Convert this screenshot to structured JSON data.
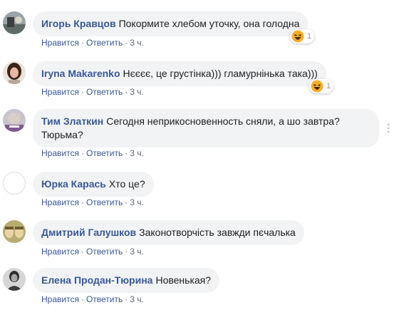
{
  "actions": {
    "like": "Нравится",
    "reply": "Ответить",
    "separator": "·"
  },
  "comments": [
    {
      "author": "Игорь Кравцов",
      "text": "Покормите хлебом уточку, она голодна",
      "time": "3 ч.",
      "reaction_icon": "haha-icon",
      "reaction_count": "1"
    },
    {
      "author": "Iryna Makarenko",
      "text": "Нєєєє, це грустінка))) гламурнінька така)))",
      "time": "3 ч.",
      "reaction_icon": "haha-icon",
      "reaction_count": "1"
    },
    {
      "author": "Тим Златкин",
      "text": "Сегодня неприкосновенность сняли, а шо завтра? Тюрьма?",
      "time": "3 ч."
    },
    {
      "author": "Юрка Карась",
      "text": "Хто це?",
      "time": "3 ч."
    },
    {
      "author": "Дмитрий Галушков",
      "text": "Законотворчість завжди пєчалька",
      "time": "3 ч."
    },
    {
      "author": "Елена Продан-Тюрина",
      "text": "Новенькая?",
      "time": "3 ч."
    }
  ],
  "colors": {
    "author": "#385898",
    "bubble": "#f2f3f5",
    "meta": "#606770"
  }
}
